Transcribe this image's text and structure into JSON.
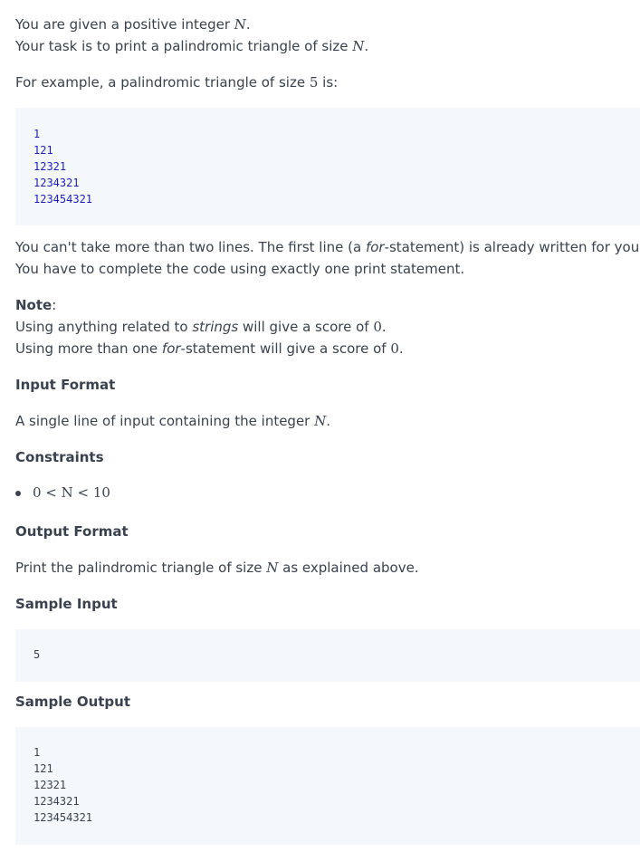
{
  "intro": {
    "line1_pre": "You are given a positive integer ",
    "line1_math": "N",
    "line1_post": ".",
    "line2_pre": "Your task is to print a palindromic triangle of size ",
    "line2_math": "N",
    "line2_post": "."
  },
  "example_intro": {
    "pre": "For example, a palindromic triangle of size ",
    "math": "5",
    "post": " is:"
  },
  "example_code": [
    "1",
    "121",
    "12321",
    "1234321",
    "123454321"
  ],
  "restriction": {
    "line1_pre": "You can't take more than two lines. The first line (a ",
    "line1_em": "for",
    "line1_post": "-statement) is already written for you.",
    "line2": "You have to complete the code using exactly one print statement."
  },
  "note": {
    "label": "Note",
    "colon": ":",
    "line1_pre": "Using anything related to ",
    "line1_em": "strings",
    "line1_mid": " will give a score of ",
    "line1_math": "0",
    "line1_post": ".",
    "line2_pre": "Using more than one ",
    "line2_em": "for",
    "line2_mid": "-statement will give a score of ",
    "line2_math": "0",
    "line2_post": "."
  },
  "input_format": {
    "heading": "Input Format",
    "text_pre": "A single line of input containing the integer ",
    "text_math": "N",
    "text_post": "."
  },
  "constraints": {
    "heading": "Constraints",
    "item": "0 < N < 10"
  },
  "output_format": {
    "heading": "Output Format",
    "text_pre": "Print the palindromic triangle of size ",
    "text_math": "N",
    "text_post": " as explained above."
  },
  "sample_input": {
    "heading": "Sample Input",
    "lines": [
      "5"
    ]
  },
  "sample_output": {
    "heading": "Sample Output",
    "lines": [
      "1",
      "121",
      "12321",
      "1234321",
      "123454321"
    ]
  }
}
